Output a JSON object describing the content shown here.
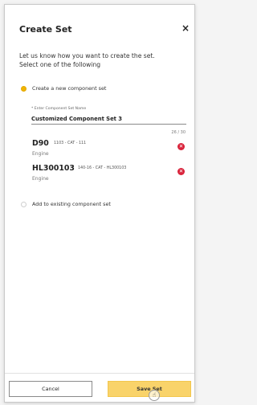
{
  "dialog": {
    "title": "Create Set",
    "close_glyph": "×",
    "intro_line1": "Let us know how you want to create the set.",
    "intro_line2": "Select one of the following"
  },
  "options": {
    "create_new_label": "Create a new component set",
    "add_existing_label": "Add to existing component set"
  },
  "name_field": {
    "label": "* Enter Component Set Name",
    "value": "Customized Component Set 3",
    "counter": "26 / 30"
  },
  "components": [
    {
      "id": "D90",
      "desc": "1103 - CAT - 111",
      "type": "Engine"
    },
    {
      "id": "HL300103",
      "desc": "140-16 - CAT - HL300103",
      "type": "Engine"
    }
  ],
  "footer": {
    "cancel_label": "Cancel",
    "save_label": "Save Set"
  },
  "icons": {
    "remove": "remove-icon",
    "cursor": "hand-pointer-icon"
  },
  "colors": {
    "accent": "#f1b400",
    "save_button": "#f9d36a",
    "remove": "#d9233b"
  }
}
